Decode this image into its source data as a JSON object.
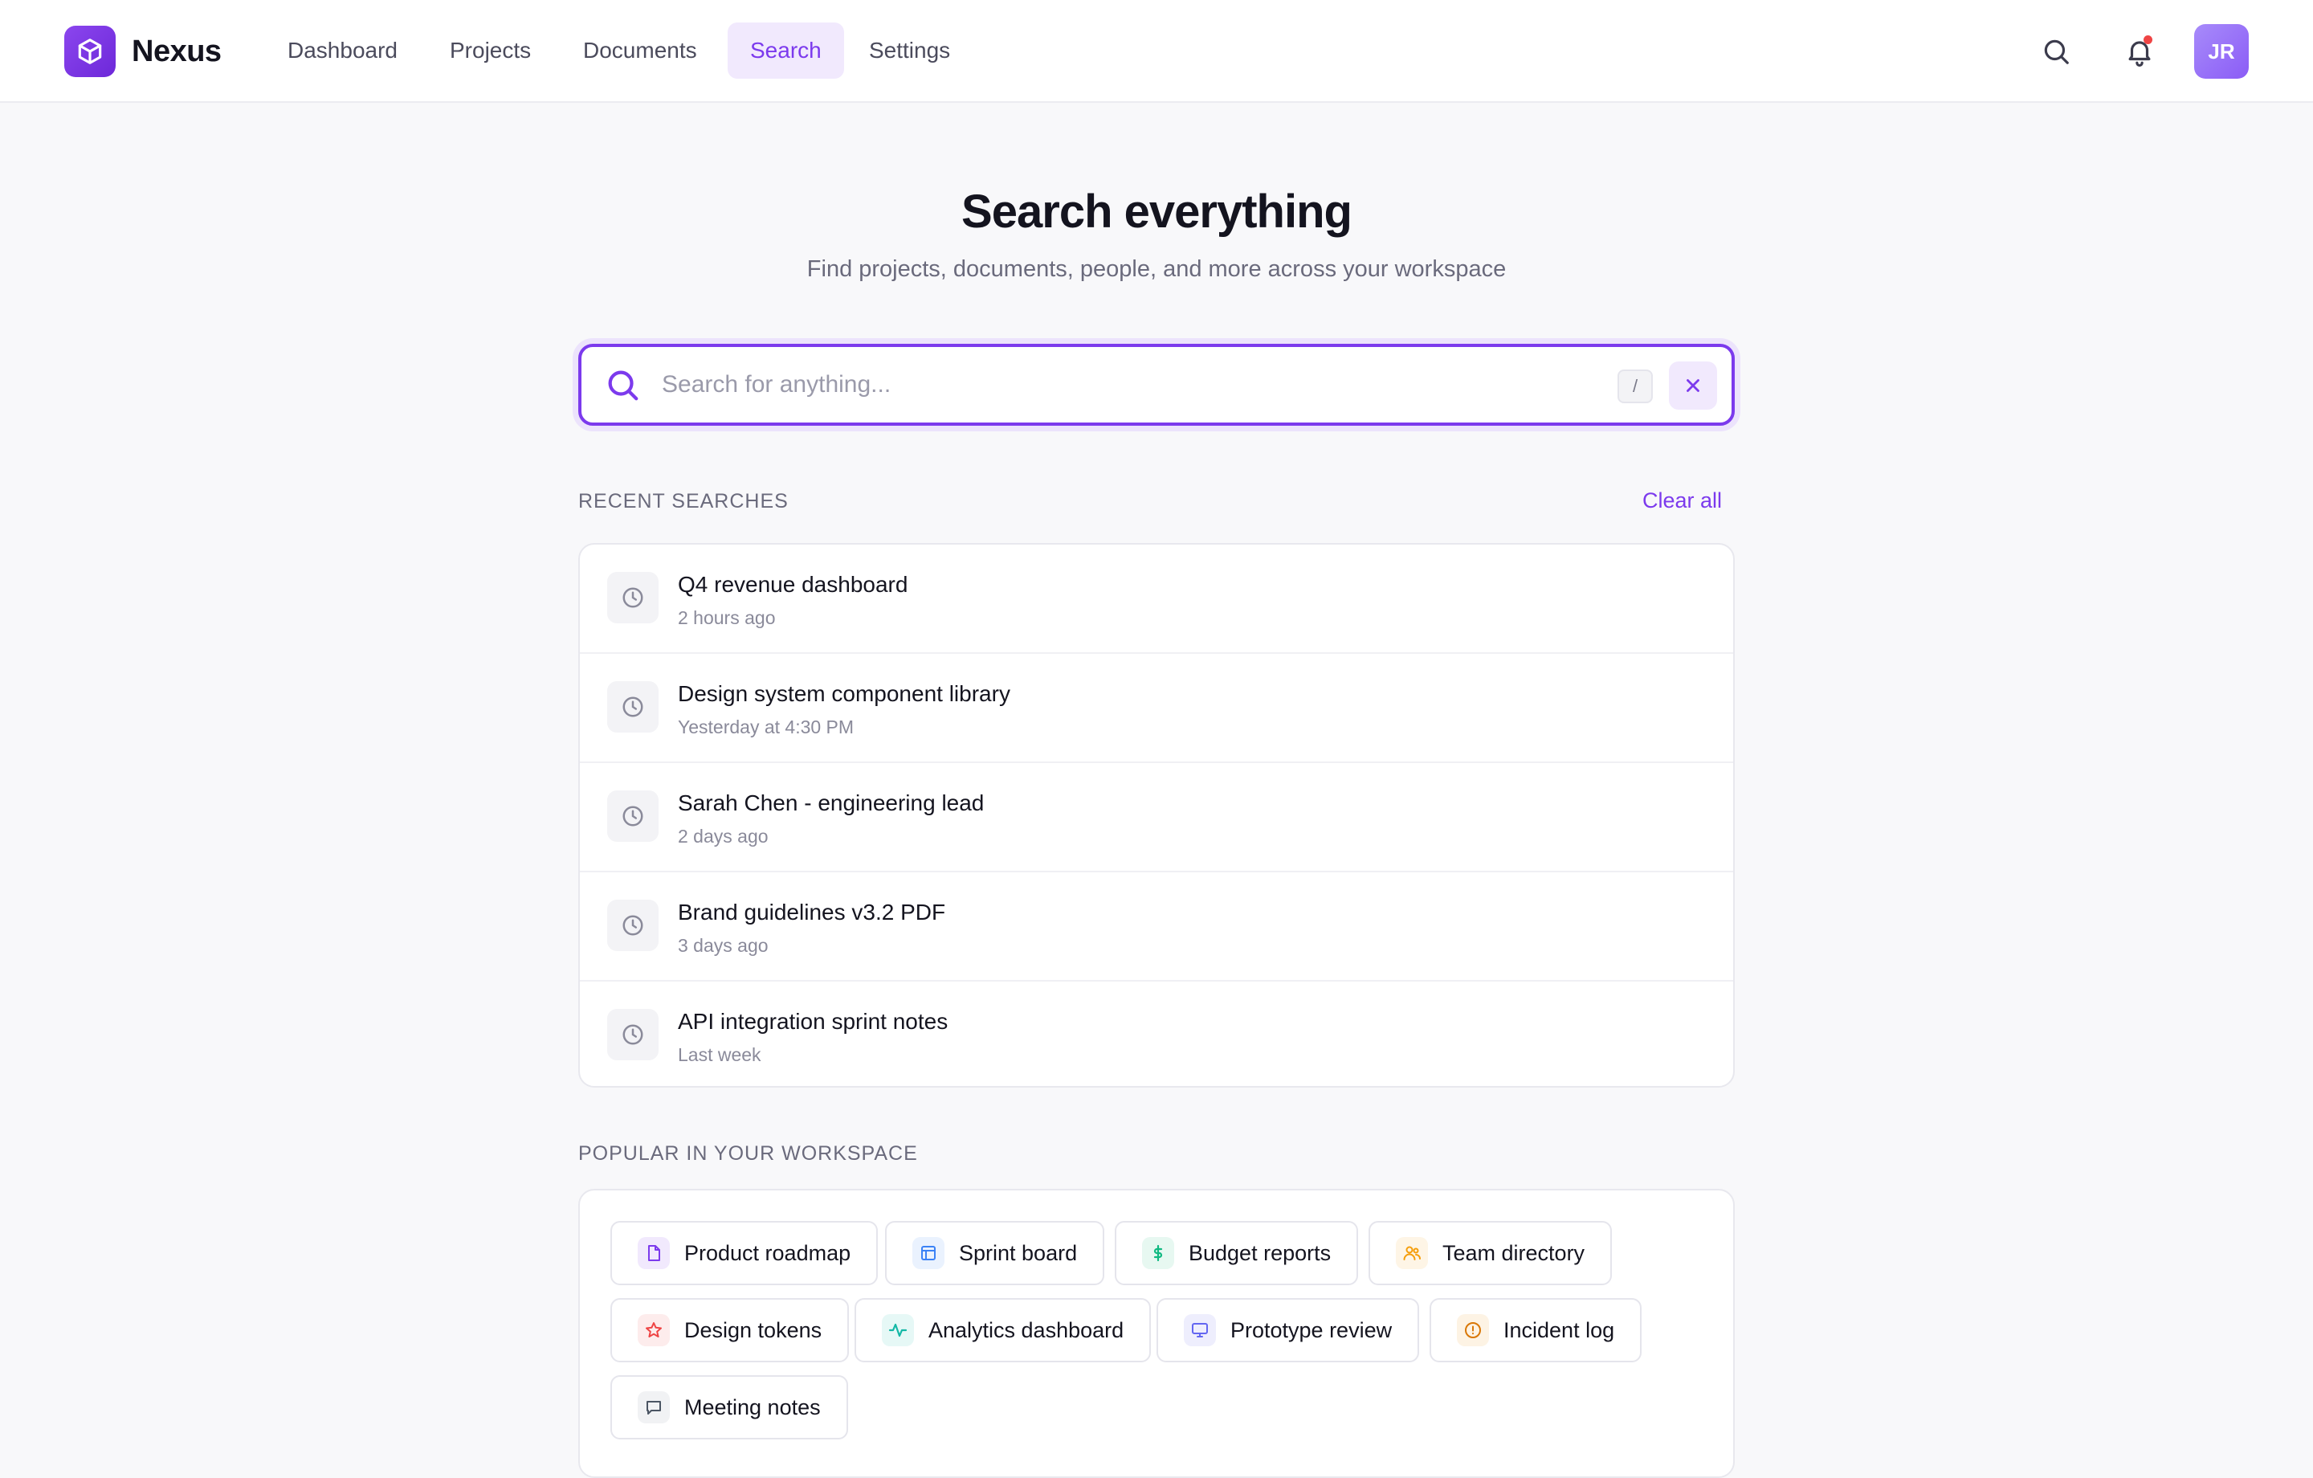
{
  "brand": {
    "name": "Nexus",
    "logo_icon": "cube-icon",
    "accent": "#7c3aed"
  },
  "nav": {
    "items": [
      {
        "label": "Dashboard",
        "active": false
      },
      {
        "label": "Projects",
        "active": false
      },
      {
        "label": "Documents",
        "active": false
      },
      {
        "label": "Search",
        "active": true
      },
      {
        "label": "Settings",
        "active": false
      }
    ]
  },
  "header": {
    "avatar_initials": "JR",
    "search_icon": "search-icon",
    "notification_icon": "bell-icon"
  },
  "hero": {
    "title": "Search everything",
    "subtitle": "Find projects, documents, people, and more across your workspace"
  },
  "search": {
    "placeholder": "Search for anything...",
    "value": "",
    "shortcut": "/"
  },
  "recent": {
    "label": "RECENT SEARCHES",
    "clear_label": "Clear all",
    "items": [
      {
        "title": "Q4 revenue dashboard",
        "time": "2 hours ago",
        "icon": "clock-icon"
      },
      {
        "title": "Design system component library",
        "time": "Yesterday at 4:30 PM",
        "icon": "clock-icon"
      },
      {
        "title": "Sarah Chen - engineering lead",
        "time": "2 days ago",
        "icon": "clock-icon"
      },
      {
        "title": "Brand guidelines v3.2 PDF",
        "time": "3 days ago",
        "icon": "clock-icon"
      },
      {
        "title": "API integration sprint notes",
        "time": "Last week",
        "icon": "clock-icon"
      }
    ]
  },
  "popular": {
    "label": "POPULAR IN YOUR WORKSPACE",
    "chips": [
      {
        "label": "Product roadmap",
        "icon": "document-icon",
        "color": "#7c3aed",
        "bg": "#f1e9fd"
      },
      {
        "label": "Sprint board",
        "icon": "layout-icon",
        "color": "#3b82f6",
        "bg": "#eaf2fe"
      },
      {
        "label": "Budget reports",
        "icon": "dollar-icon",
        "color": "#10b981",
        "bg": "#e7f8f1"
      },
      {
        "label": "Team directory",
        "icon": "users-icon",
        "color": "#f59e0b",
        "bg": "#fef5e6"
      },
      {
        "label": "Design tokens",
        "icon": "star-icon",
        "color": "#ef4444",
        "bg": "#fdecec"
      },
      {
        "label": "Analytics dashboard",
        "icon": "activity-icon",
        "color": "#14b8a6",
        "bg": "#e6f8f6"
      },
      {
        "label": "Prototype review",
        "icon": "monitor-icon",
        "color": "#6366f1",
        "bg": "#eeeefd"
      },
      {
        "label": "Incident log",
        "icon": "alert-circle-icon",
        "color": "#d97706",
        "bg": "#fdf3e4"
      },
      {
        "label": "Meeting notes",
        "icon": "message-icon",
        "color": "#4b5563",
        "bg": "#f1f2f4"
      }
    ]
  }
}
